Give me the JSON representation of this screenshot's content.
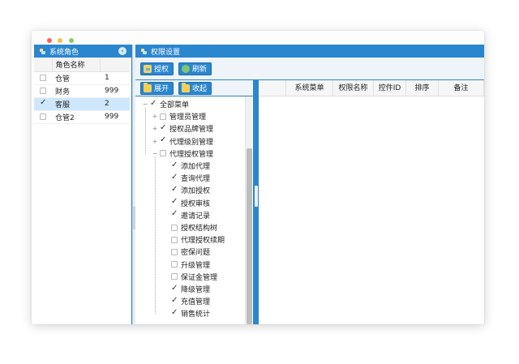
{
  "left_panel": {
    "title": "系统角色",
    "collapse_icon": "chevron-left-icon",
    "column_header": "角色名称",
    "roles": [
      {
        "name": "仓管",
        "value": "1",
        "checked": false,
        "selected": false
      },
      {
        "name": "财务",
        "value": "999",
        "checked": false,
        "selected": false
      },
      {
        "name": "客服",
        "value": "2",
        "checked": true,
        "selected": true
      },
      {
        "name": "仓管2",
        "value": "999",
        "checked": false,
        "selected": false
      }
    ]
  },
  "right_panel": {
    "title": "权限设置",
    "toolbar": {
      "grant_label": "授权",
      "refresh_label": "刷新"
    },
    "tree_toolbar": {
      "expand_label": "展开",
      "collapse_label": "收起"
    },
    "tree": {
      "root": {
        "label": "全部菜单",
        "checked": true
      },
      "groups": [
        {
          "label": "管理员管理",
          "checked": false,
          "expanded": false
        },
        {
          "label": "授权品牌管理",
          "checked": true,
          "expanded": false
        },
        {
          "label": "代理级别管理",
          "checked": true,
          "expanded": false
        },
        {
          "label": "代理授权管理",
          "checked": false,
          "expanded": true
        }
      ],
      "children": [
        {
          "label": "添加代理",
          "checked": true
        },
        {
          "label": "查询代理",
          "checked": true
        },
        {
          "label": "添加授权",
          "checked": true
        },
        {
          "label": "授权审核",
          "checked": true
        },
        {
          "label": "邀请记录",
          "checked": true
        },
        {
          "label": "授权结构树",
          "checked": false
        },
        {
          "label": "代理授权续期",
          "checked": false
        },
        {
          "label": "密保问题",
          "checked": false
        },
        {
          "label": "升级管理",
          "checked": false
        },
        {
          "label": "保证金管理",
          "checked": false
        },
        {
          "label": "降级管理",
          "checked": true
        },
        {
          "label": "充值管理",
          "checked": true
        },
        {
          "label": "销售统计",
          "checked": true
        }
      ]
    },
    "grid": {
      "columns": [
        "系统菜单",
        "权限名称",
        "控件ID",
        "排序",
        "备注"
      ]
    }
  },
  "colors": {
    "accent": "#2b86d0",
    "selected_row": "#cfe7fb"
  }
}
